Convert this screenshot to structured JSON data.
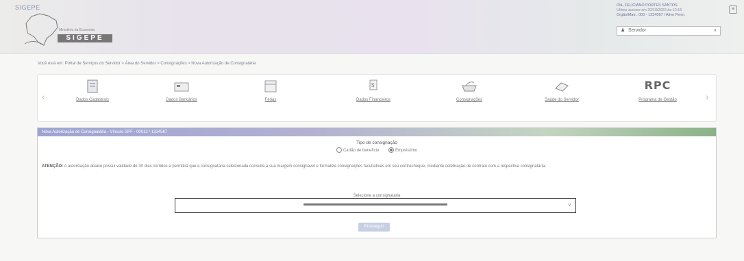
{
  "header": {
    "app_name": "SIGEPE",
    "org_label": "Ministério da Economia",
    "logo_text": "SIGEPE",
    "user_lines": [
      "Olá, FELICIANO PORTES SANTOS",
      "Último acesso em 20/10/2023 às 10:15",
      "Órgão/Matr.: 000 - 1234567 / Ativo Perm."
    ],
    "profile_select": "Servidor"
  },
  "breadcrumb": "Você está em: Portal de Serviços do Servidor > Área do Servidor > Consignações > Nova Autorização de Consignatária",
  "menu": {
    "items": [
      {
        "label": "Dados Cadastrais",
        "icon": "document-icon"
      },
      {
        "label": "Dados Bancários",
        "icon": "card-icon"
      },
      {
        "label": "Férias",
        "icon": "calendar-icon"
      },
      {
        "label": "Dados Financeiros",
        "icon": "money-icon"
      },
      {
        "label": "Consignações",
        "icon": "tray-icon"
      },
      {
        "label": "Saúde do Servidor",
        "icon": "health-icon"
      },
      {
        "label": "Programa de Gestão",
        "icon": "rpc-icon"
      }
    ],
    "rpc_text": "RPC"
  },
  "panel": {
    "title": "Nova Autorização de Consignatária - Vínculo SPF - 00012 / 1234567",
    "tipo_title": "Tipo de consignação",
    "option_1": "Cartão de benefício",
    "option_2": "Empréstimo",
    "attention_prefix": "ATENÇÃO:",
    "attention_text": " A autorização abaixo possui validade de 30 dias corridos e permitirá que a consignatária selecionada consulte a sua margem consignável e formalize consignações facultativas em seu contracheque, mediante celebração de contrato com a respectiva consignatária.",
    "select_label": "Selecione a consignatária",
    "button_label": "Prosseguir"
  },
  "colors": {
    "header_grad_start": "#ececea",
    "panel_header_grad_end": "#8ab287",
    "button": "#c7cfe3"
  }
}
